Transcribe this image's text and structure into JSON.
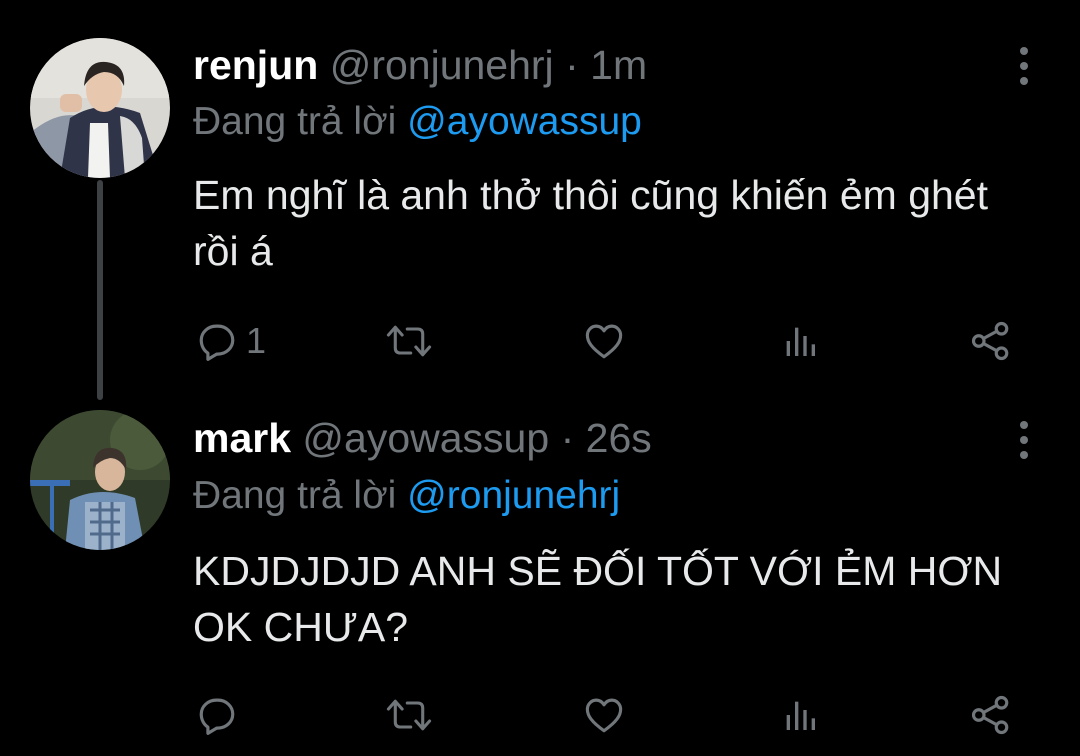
{
  "tweets": [
    {
      "display_name": "renjun",
      "handle": "@ronjunehrj",
      "separator": "·",
      "time": "1m",
      "reply_prefix": "Đang trả lời",
      "reply_to": "@ayowassup",
      "text": "Em nghĩ là anh thở thôi cũng khiến ẻm ghét rồi á",
      "reply_count": "1",
      "icons": [
        "reply-icon",
        "retweet-icon",
        "like-icon",
        "stats-icon",
        "share-icon",
        "more-icon"
      ]
    },
    {
      "display_name": "mark",
      "handle": "@ayowassup",
      "separator": "·",
      "time": "26s",
      "reply_prefix": "Đang trả lời",
      "reply_to": "@ronjunehrj",
      "text": "KDJDJDJD ANH SẼ ĐỐI TỐT VỚI ẺM HƠN OK CHƯA?",
      "reply_count": "",
      "icons": [
        "reply-icon",
        "retweet-icon",
        "like-icon",
        "stats-icon",
        "share-icon",
        "more-icon"
      ]
    }
  ],
  "colors": {
    "background": "#000000",
    "text_primary": "#e7e9ea",
    "text_secondary": "#71767b",
    "mention": "#1d9bf0",
    "thread_line": "#3e4144"
  }
}
